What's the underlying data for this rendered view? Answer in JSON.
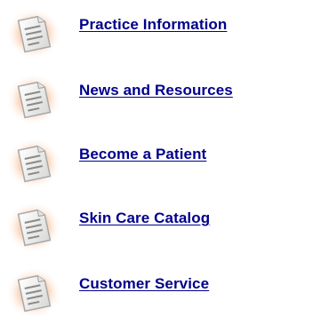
{
  "colors": {
    "link": "#00008b",
    "icon_glow": "#f8c9a8",
    "icon_page": "#f4f4f2",
    "icon_outline": "#a8a8a8",
    "icon_lines": "#8a8a8a"
  },
  "menu": {
    "icon_name": "document-icon",
    "items": [
      {
        "label": "Practice Information"
      },
      {
        "label": "News and Resources"
      },
      {
        "label": "Become a Patient"
      },
      {
        "label": "Skin Care Catalog"
      },
      {
        "label": "Customer Service"
      }
    ]
  }
}
